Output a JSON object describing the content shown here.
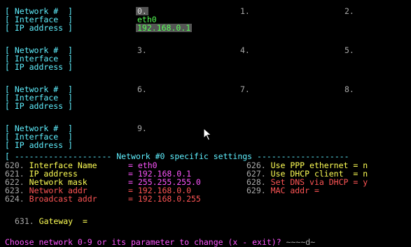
{
  "networks_grid": {
    "labels": {
      "network": "[ Network #  ]",
      "interface": "[ Interface  ]",
      "ip": "[ IP address ]"
    },
    "slots": [
      "0.",
      "1.",
      "2.",
      "3.",
      "4.",
      "5.",
      "6.",
      "7.",
      "8.",
      "9."
    ],
    "net0": {
      "interface": "eth0",
      "ip": "192.168.0.1"
    }
  },
  "settings": {
    "header_left": "[ -------------------- ",
    "header_title": "Network #0 specific settings",
    "header_right": " -------------------",
    "left": [
      {
        "num": "620.",
        "label": "Interface Name",
        "eq": "= eth0"
      },
      {
        "num": "621.",
        "label": "IP address",
        "eq": "= 192.168.0.1"
      },
      {
        "num": "622.",
        "label": "Network mask",
        "eq": "= 255.255.255.0"
      },
      {
        "num": "623.",
        "label": "Network addr",
        "eq": "= 192.168.0.0"
      },
      {
        "num": "624.",
        "label": "Broadcast addr",
        "eq": "= 192.168.0.255"
      }
    ],
    "right": [
      {
        "num": "626.",
        "label": "Use PPP ethernet",
        "eq": "= n"
      },
      {
        "num": "627.",
        "label": "Use DHCP client",
        "eq": "= n"
      },
      {
        "num": "628.",
        "label": "Set DNS via DHCP",
        "eq": "= y"
      },
      {
        "num": "629.",
        "label": "MAC addr",
        "eq": "="
      }
    ],
    "gateway": {
      "num": "631.",
      "label": "Gateway",
      "eq": "="
    }
  },
  "prompt": {
    "text": "Choose network 0-9 or its parameter to change (x - exit)? ",
    "input": "~~~~d~"
  },
  "colors": {
    "cyan": "#5ff0ff",
    "yellow": "#ffff55",
    "red": "#ff5555",
    "magenta": "#ff55ff",
    "green": "#55ff55"
  }
}
